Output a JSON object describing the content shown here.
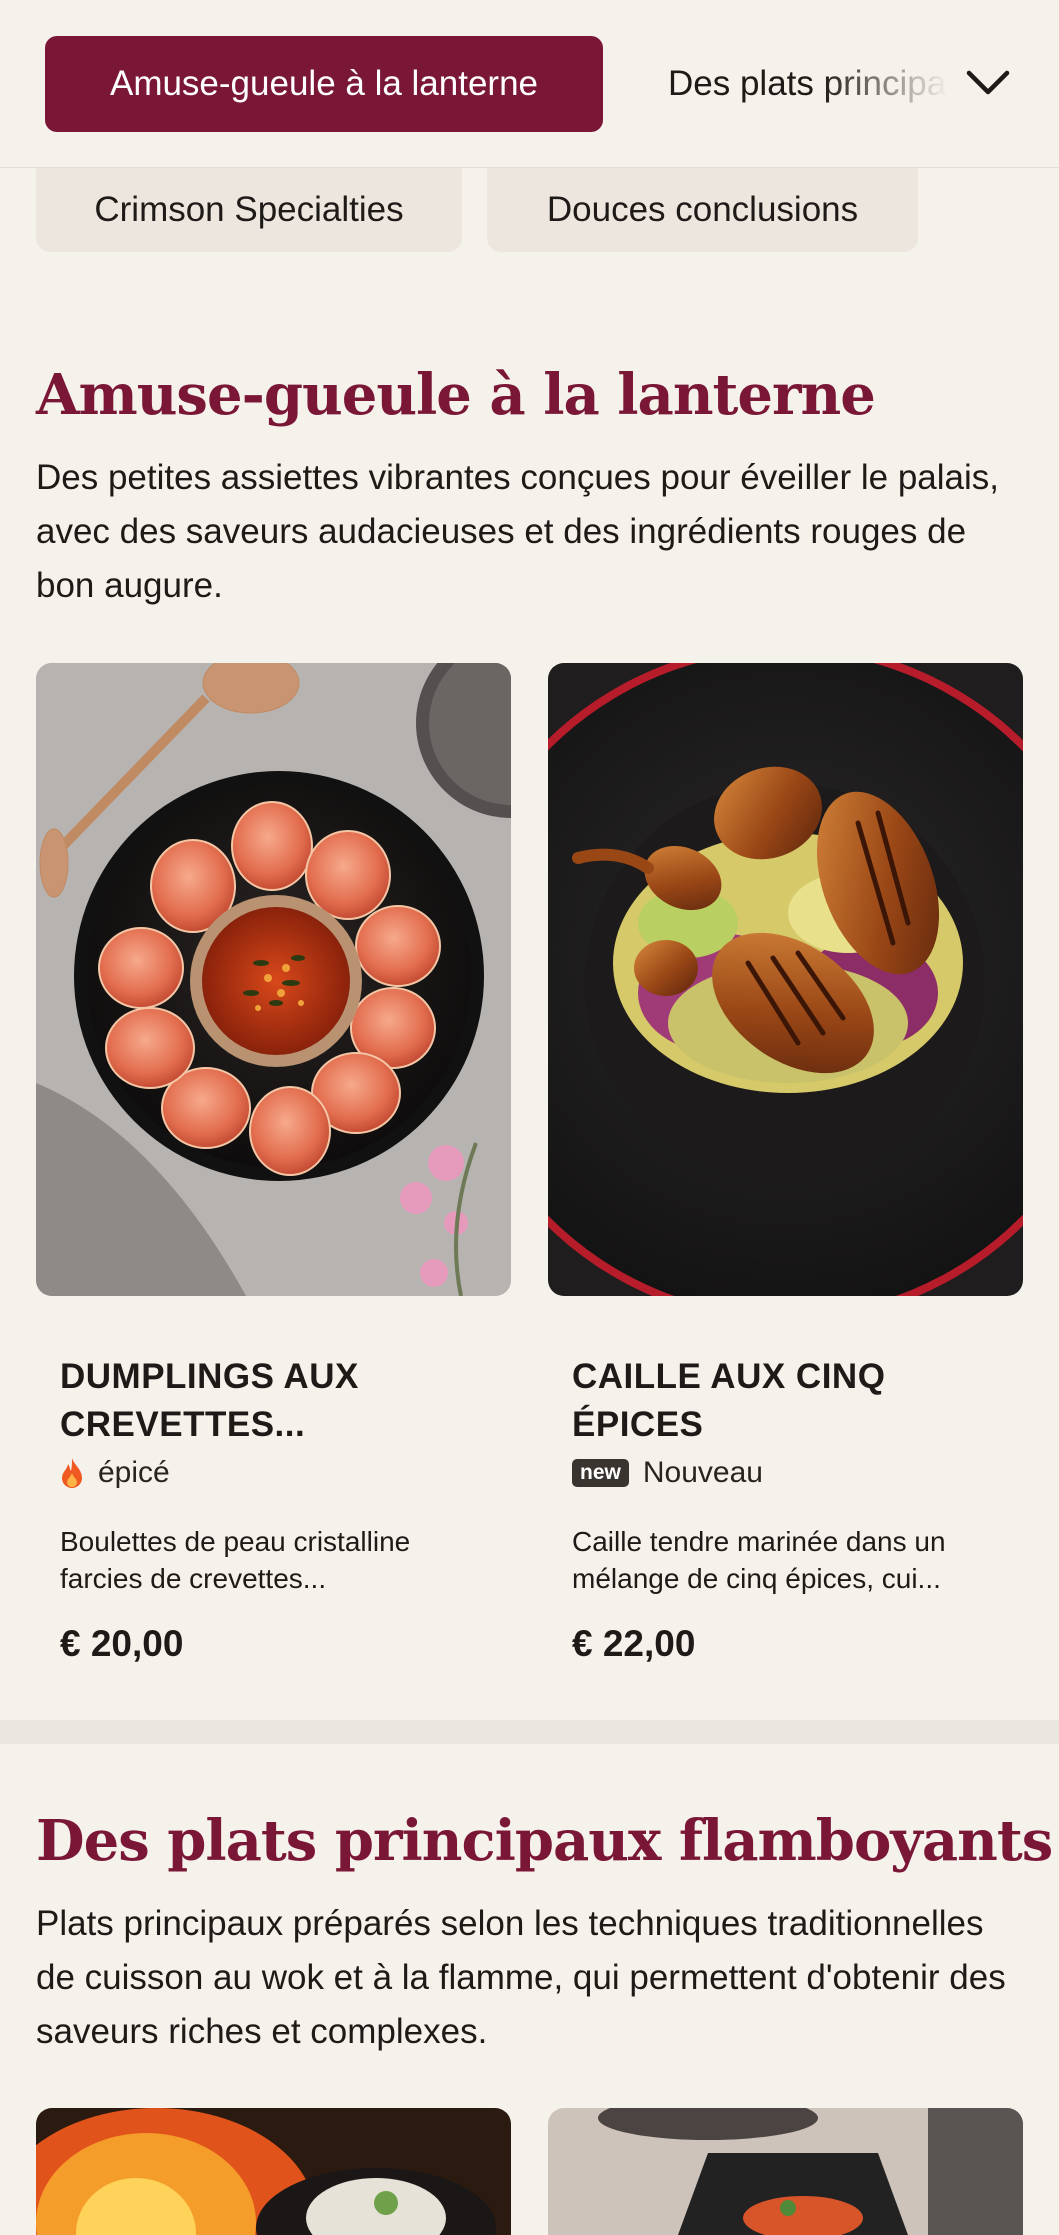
{
  "nav": {
    "active_tab": "Amuse-gueule à la lanterne",
    "next_tab": "Des plats principaux flamboyants",
    "more_icon": "chevron-down-icon",
    "chips": [
      "Crimson Specialties",
      "Douces conclusions"
    ]
  },
  "sections": [
    {
      "title": "Amuse-gueule à la lanterne",
      "description": "Des petites assiettes vibrantes conçues pour éveiller le palais, avec des saveurs audacieuses et des ingrédients rouges de bon augure.",
      "items": [
        {
          "name": "Dumplings aux crevettes...",
          "tag": "épicé",
          "tag_icon": "flame-icon",
          "description": "Boulettes de peau cristalline farcies de crevettes...",
          "price": "€ 20,00"
        },
        {
          "name": "Caille aux cinq épices",
          "badge": "new",
          "tag": "Nouveau",
          "description": "Caille tendre marinée dans un mélange de cinq épices, cui...",
          "price": "€ 22,00"
        }
      ]
    },
    {
      "title": "Des plats principaux flamboyants",
      "description": "Plats principaux préparés selon les techniques traditionnelles de cuisson au wok et à la flamme, qui permettent d'obtenir des saveurs riches et complexes."
    }
  ],
  "colors": {
    "accent": "#7a1737",
    "background": "#f5f1eb",
    "chip": "#ece6df"
  }
}
